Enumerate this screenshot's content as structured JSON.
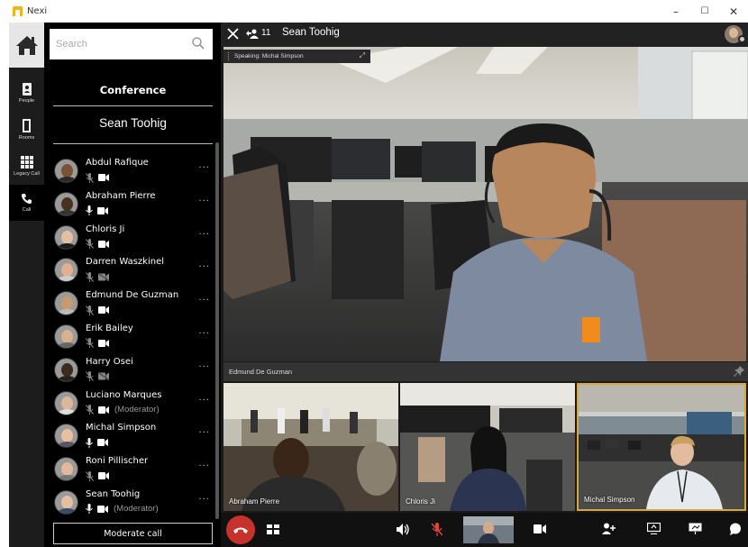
{
  "app": {
    "name": "Nexi"
  },
  "window_controls": {
    "minimize": "–",
    "maximize": "☐",
    "close": "✕"
  },
  "rail": {
    "items": [
      {
        "id": "people",
        "label": "People"
      },
      {
        "id": "rooms",
        "label": "Rooms"
      },
      {
        "id": "legacy",
        "label": "Legacy Call"
      },
      {
        "id": "call",
        "label": "Call",
        "active": true
      }
    ]
  },
  "search": {
    "placeholder": "Search"
  },
  "conference": {
    "heading": "Conference",
    "name": "Sean Toohig"
  },
  "participants": [
    {
      "name": "Abdul Rafique",
      "mic": "muted",
      "cam": "on",
      "role": "",
      "skin": "#7a5234",
      "shirt": "#2b2b2b"
    },
    {
      "name": "Abraham Pierre",
      "mic": "on",
      "cam": "on",
      "role": "",
      "skin": "#4a3020",
      "shirt": "#333"
    },
    {
      "name": "Chloris Ji",
      "mic": "muted",
      "cam": "on",
      "role": "",
      "skin": "#e3c0a0",
      "shirt": "#1c1c1c"
    },
    {
      "name": "Darren Waszkinel",
      "mic": "muted",
      "cam": "off",
      "role": "",
      "skin": "#e0b090",
      "shirt": "#ccc"
    },
    {
      "name": "Edmund De Guzman",
      "mic": "muted",
      "cam": "on",
      "role": "",
      "skin": "#c89a70",
      "shirt": "#bbb"
    },
    {
      "name": "Erik Bailey",
      "mic": "muted",
      "cam": "on",
      "role": "",
      "skin": "#d9b090",
      "shirt": "#666"
    },
    {
      "name": "Harry Osei",
      "mic": "muted",
      "cam": "off",
      "role": "",
      "skin": "#3d2a1e",
      "shirt": "#222"
    },
    {
      "name": "Luciano Marques",
      "mic": "muted",
      "cam": "on",
      "role": "(Moderator)",
      "skin": "#dcb89a",
      "shirt": "#ddd"
    },
    {
      "name": "Michal Simpson",
      "mic": "on",
      "cam": "on",
      "role": "",
      "skin": "#e8c0a0",
      "shirt": "#556"
    },
    {
      "name": "Roni Pillischer",
      "mic": "muted",
      "cam": "on",
      "role": "",
      "skin": "#e2b89c",
      "shirt": "#777"
    },
    {
      "name": "Sean Toohig",
      "mic": "on",
      "cam": "on",
      "role": "(Moderator)",
      "skin": "#e4bfa0",
      "shirt": "#3a4a6a"
    }
  ],
  "moderate_button": "Moderate call",
  "call": {
    "participant_count": "11",
    "title": "Sean Toohig",
    "speaking": "Speaking: Michal Simpson",
    "main_video_name": "Edmund De Guzman",
    "tiles": [
      {
        "name": "Abraham Pierre"
      },
      {
        "name": "Chloris Ji"
      },
      {
        "name": "Michal Simpson",
        "active": true
      }
    ]
  },
  "colors": {
    "accent_active": "#d8a83a",
    "hangup": "#c8322c",
    "mute_red": "#e0443c"
  }
}
